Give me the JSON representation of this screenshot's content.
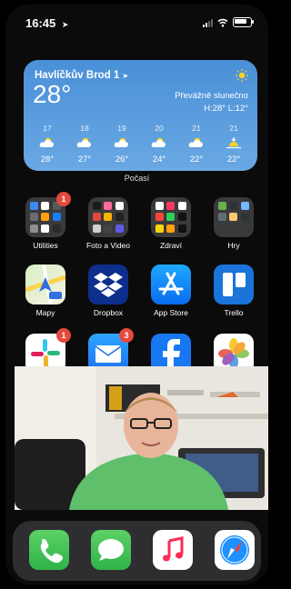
{
  "status_bar": {
    "time": "16:45",
    "location_icon": "location-arrow-icon",
    "signal_icon": "cellular-signal-icon",
    "wifi_icon": "wifi-icon",
    "battery_icon": "battery-icon"
  },
  "weather_widget": {
    "city": "Havlíčkův Brod 1",
    "temperature": "28°",
    "condition": "Převážně slunečno",
    "high_low": "H:28° L:12°",
    "label": "Počasí",
    "forecast": [
      {
        "hour": "17",
        "temp": "28°",
        "icon": "partly-sunny-icon"
      },
      {
        "hour": "18",
        "temp": "27°",
        "icon": "partly-sunny-icon"
      },
      {
        "hour": "19",
        "temp": "26°",
        "icon": "partly-sunny-icon"
      },
      {
        "hour": "20",
        "temp": "24°",
        "icon": "partly-sunny-icon"
      },
      {
        "hour": "21",
        "temp": "22°",
        "icon": "partly-sunny-icon"
      },
      {
        "hour": "21",
        "temp": "22°",
        "icon": "sunset-icon"
      }
    ]
  },
  "home_rows": [
    [
      {
        "label": "Utilities",
        "type": "folder",
        "badge": "1"
      },
      {
        "label": "Foto a Video",
        "type": "folder",
        "badge": ""
      },
      {
        "label": "Zdraví",
        "type": "folder",
        "badge": ""
      },
      {
        "label": "Hry",
        "type": "folder",
        "badge": ""
      }
    ],
    [
      {
        "label": "Mapy",
        "icon": "maps-icon",
        "badge": ""
      },
      {
        "label": "Dropbox",
        "icon": "dropbox-icon",
        "badge": ""
      },
      {
        "label": "App Store",
        "icon": "app-store-icon",
        "badge": ""
      },
      {
        "label": "Trello",
        "icon": "trello-icon",
        "badge": ""
      }
    ],
    [
      {
        "label": "",
        "icon": "slack-icon",
        "badge": "1"
      },
      {
        "label": "",
        "icon": "mail-icon",
        "badge": "3"
      },
      {
        "label": "",
        "icon": "facebook-icon",
        "badge": ""
      },
      {
        "label": "",
        "icon": "photos-icon",
        "badge": ""
      }
    ]
  ],
  "dock": [
    {
      "icon": "phone-icon"
    },
    {
      "icon": "messages-icon"
    },
    {
      "icon": "music-icon"
    },
    {
      "icon": "safari-icon"
    }
  ],
  "overlay": {
    "type": "picture-in-picture-video"
  },
  "colors": {
    "weather_top": "#4a90d8",
    "weather_bottom": "#69a8e3",
    "badge": "#e5493c",
    "background": "#0b0b0b"
  }
}
